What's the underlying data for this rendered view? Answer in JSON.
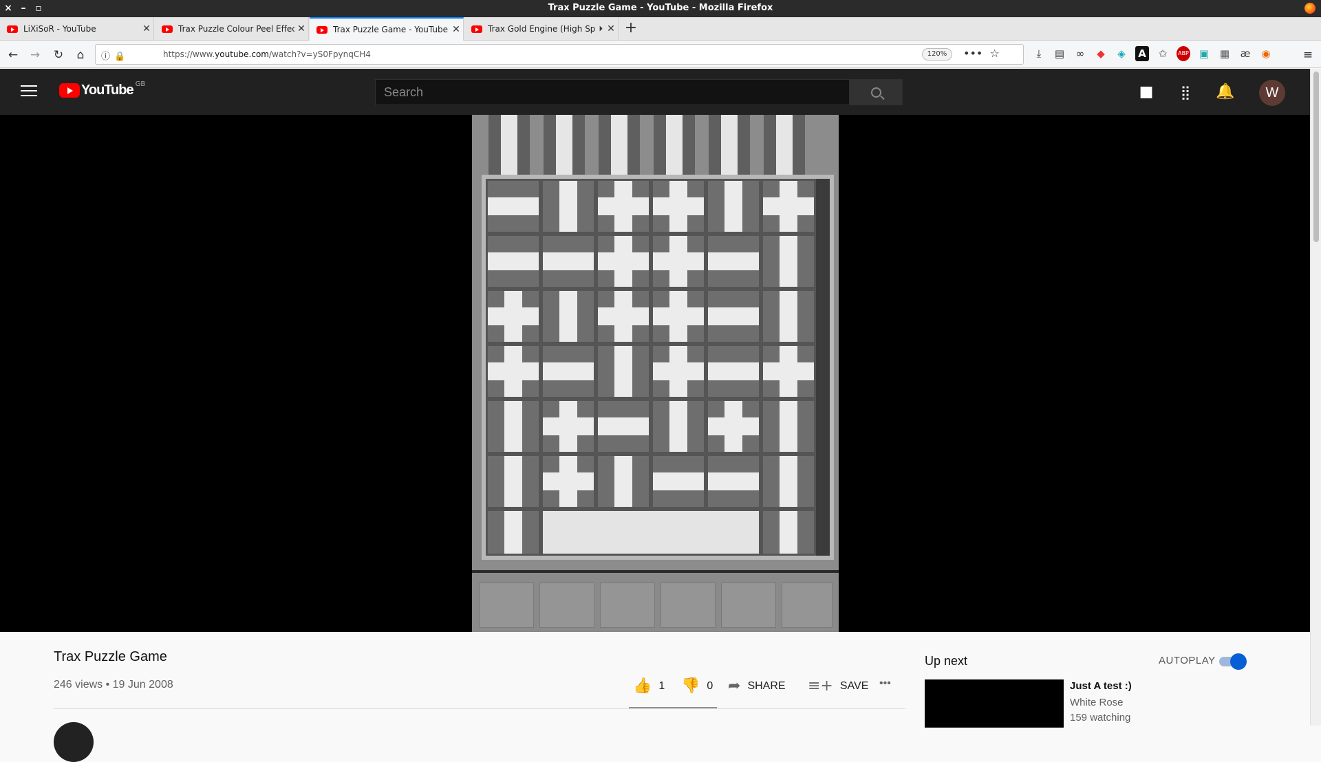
{
  "window": {
    "title": "Trax Puzzle Game - YouTube - Mozilla Firefox",
    "controls": [
      "×",
      "–",
      "▫"
    ]
  },
  "tabs": [
    {
      "label": "LiXiSoR - YouTube",
      "active": false
    },
    {
      "label": "Trax Puzzle Colour Peel Effec",
      "active": false
    },
    {
      "label": "Trax Puzzle Game - YouTube",
      "active": true
    },
    {
      "label": "Trax Gold Engine (High Sp",
      "active": false,
      "audio": true
    }
  ],
  "newtab_label": "+",
  "nav": {
    "url_host": "https://www.",
    "url_domain": "youtube.com",
    "url_path": "/watch?v=yS0FpynqCH4",
    "zoom": "120%"
  },
  "youtube": {
    "logo_text": "YouTube",
    "country_code": "GB",
    "search_placeholder": "Search",
    "avatar_letter": "W"
  },
  "video": {
    "title": "Trax Puzzle Game",
    "views": "246 views",
    "date": "19 Jun 2008",
    "likes": "1",
    "dislikes": "0",
    "share_label": "SHARE",
    "save_label": "SAVE",
    "more_label": "•••",
    "sentiment_like_fraction": 1.0
  },
  "sidebar": {
    "up_next_label": "Up next",
    "autoplay_label": "AUTOPLAY",
    "autoplay_on": true,
    "items": [
      {
        "title": "Just A test :)",
        "channel": "White Rose",
        "watching": "159 watching"
      }
    ]
  },
  "icons": {
    "colors": {
      "youtube_red": "#ff0000",
      "masthead": "#212121",
      "accent": "#065fd4",
      "firefox_tab_accent": "#0a84ff"
    }
  }
}
